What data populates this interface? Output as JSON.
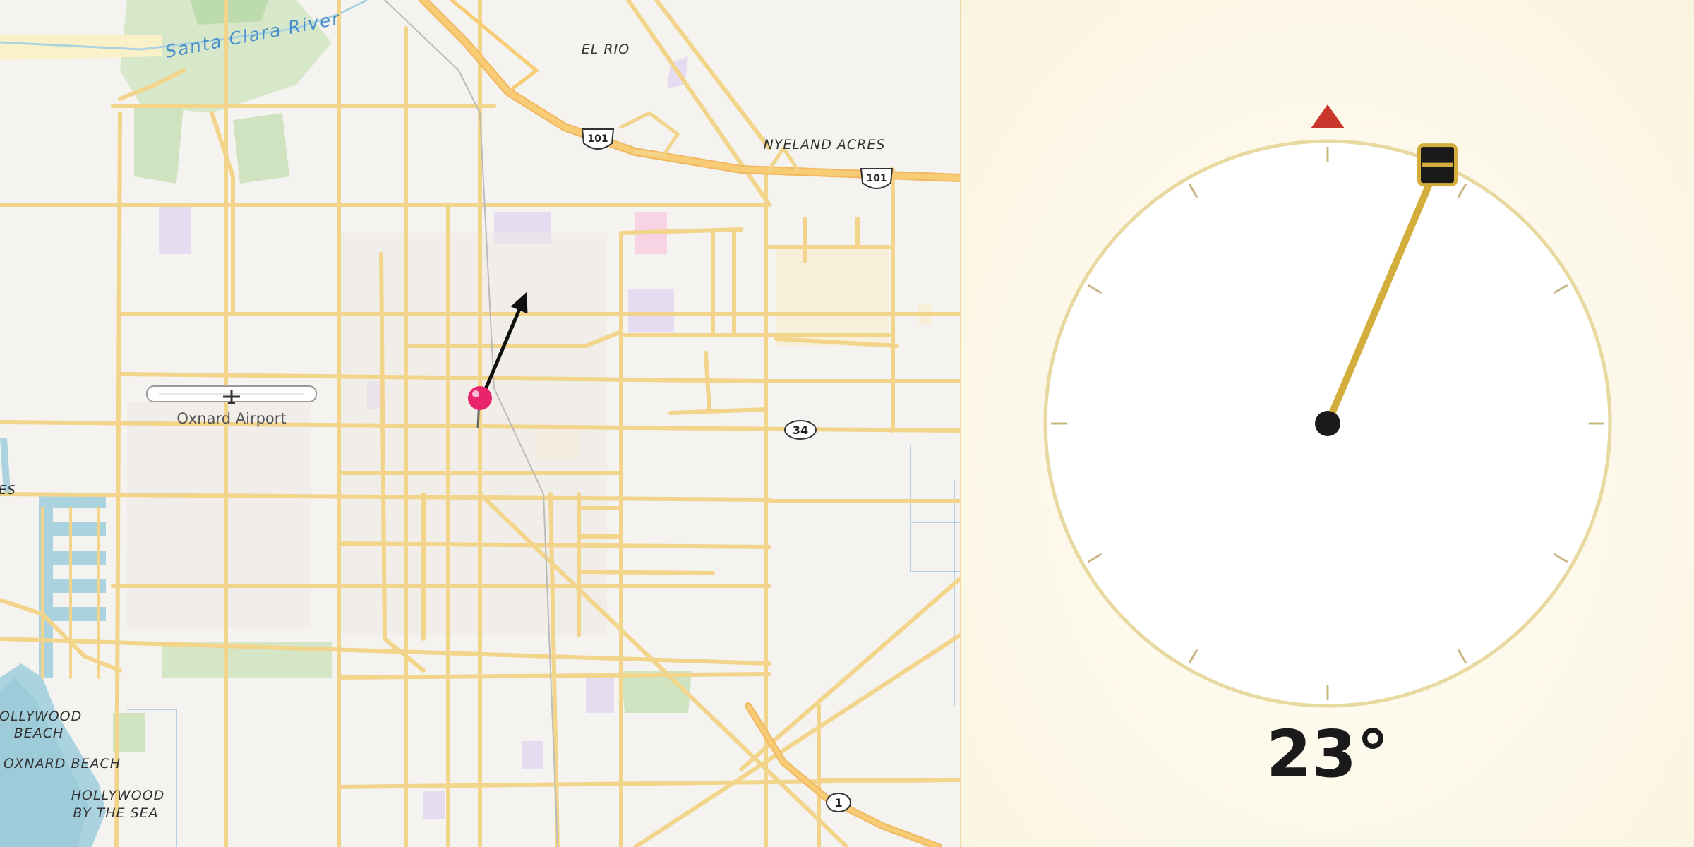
{
  "map": {
    "places": {
      "el_rio": "EL RIO",
      "nyeland_acres": "NYELAND ACRES",
      "hollywood_beach_1": "HOLLYWOOD",
      "hollywood_beach_2": "BEACH",
      "oxnard_beach": "OXNARD BEACH",
      "hollywood_by_the_sea_1": "HOLLYWOOD",
      "hollywood_by_the_sea_2": "BY THE SEA",
      "edge_fragment": "ES"
    },
    "river": "Santa Clara River",
    "airport": "Oxnard Airport",
    "shields": {
      "us101_a": "101",
      "us101_b": "101",
      "sr34": "34",
      "sr1": "1"
    },
    "pin_color": "#e8246c",
    "arrow_color": "#111111"
  },
  "compass": {
    "heading_deg": 23,
    "heading_text": "23°",
    "north_marker_color": "#c9372c",
    "needle_color": "#d4ae3c",
    "ring_color": "#e8d9a0"
  }
}
